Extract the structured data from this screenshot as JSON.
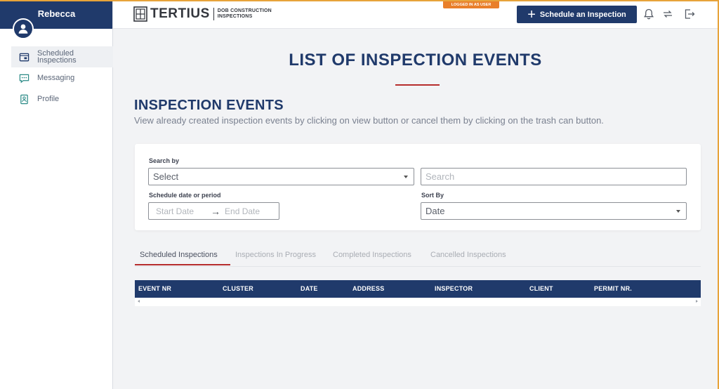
{
  "sidebar": {
    "user_name": "Rebecca",
    "items": [
      {
        "label": "Scheduled\nInspections",
        "icon": "calendar-icon",
        "active": true
      },
      {
        "label": "Messaging",
        "icon": "chat-icon",
        "active": false
      },
      {
        "label": "Profile",
        "icon": "profile-icon",
        "active": false
      }
    ]
  },
  "header": {
    "brand": "TERTIUS",
    "brand_sub_line1": "DOB CONSTRUCTION",
    "brand_sub_line2": "INSPECTIONS",
    "logged_badge": "LOGGED IN AS USER",
    "schedule_button": "Schedule an Inspection",
    "icons": [
      "bell-icon",
      "refresh-icon",
      "logout-icon"
    ]
  },
  "main": {
    "page_title": "LIST OF INSPECTION EVENTS",
    "section_title": "INSPECTION EVENTS",
    "section_desc": "View already created inspection events by clicking on view button or cancel them by clicking on the trash can button.",
    "filters": {
      "search_by_label": "Search by",
      "search_by_value": "Select",
      "search_placeholder": "Search",
      "date_label": "Schedule date or period",
      "start_date": "Start Date",
      "end_date": "End Date",
      "sort_label": "Sort By",
      "sort_value": "Date"
    },
    "tabs": [
      {
        "label": "Scheduled Inspections",
        "active": true
      },
      {
        "label": "Inspections In Progress",
        "active": false
      },
      {
        "label": "Completed Inspections",
        "active": false
      },
      {
        "label": "Cancelled Inspections",
        "active": false
      }
    ],
    "table": {
      "columns": [
        "EVENT NR",
        "CLUSTER",
        "DATE",
        "ADDRESS",
        "INSPECTOR",
        "CLIENT",
        "PERMIT NR."
      ],
      "rows": []
    }
  },
  "colors": {
    "primary": "#203a6b",
    "accent_red": "#b62d2d",
    "badge_orange": "#e97f2a"
  }
}
